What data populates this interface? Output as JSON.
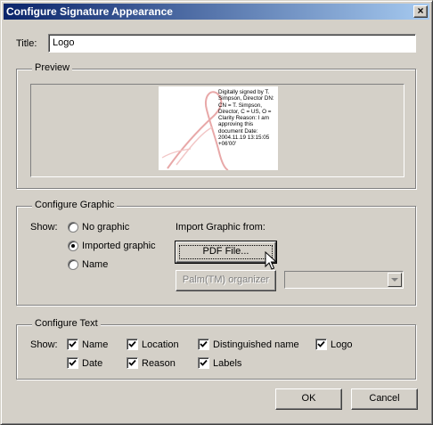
{
  "window": {
    "title": "Configure Signature Appearance",
    "close_glyph": "×"
  },
  "title_field": {
    "label": "Title:",
    "value": "Logo"
  },
  "preview": {
    "group_label": "Preview",
    "signature_text": "Digitally signed by T. Simpson, Director DN: CN = T. Simpson, Director, C = US, O = Clarity Reason: I am approving this document Date: 2004.11.19 13:15:05 +06'00'"
  },
  "configure_graphic": {
    "group_label": "Configure Graphic",
    "show_label": "Show:",
    "options": [
      {
        "label": "No graphic",
        "selected": false
      },
      {
        "label": "Imported graphic",
        "selected": true
      },
      {
        "label": "Name",
        "selected": false
      }
    ],
    "import_label": "Import Graphic from:",
    "pdf_button": "PDF File...",
    "palm_button": "Palm(TM) organizer",
    "palm_select_value": ""
  },
  "configure_text": {
    "group_label": "Configure Text",
    "show_label": "Show:",
    "checkboxes": [
      {
        "label": "Name",
        "checked": true
      },
      {
        "label": "Location",
        "checked": true
      },
      {
        "label": "Distinguished name",
        "checked": true
      },
      {
        "label": "Logo",
        "checked": true
      },
      {
        "label": "Date",
        "checked": true
      },
      {
        "label": "Reason",
        "checked": true
      },
      {
        "label": "Labels",
        "checked": true
      }
    ]
  },
  "buttons": {
    "ok": "OK",
    "cancel": "Cancel"
  },
  "icons": {
    "close": "close-icon",
    "cursor": "mouse-pointer-icon",
    "check": "checkmark-icon",
    "dropdown": "chevron-down-icon"
  }
}
